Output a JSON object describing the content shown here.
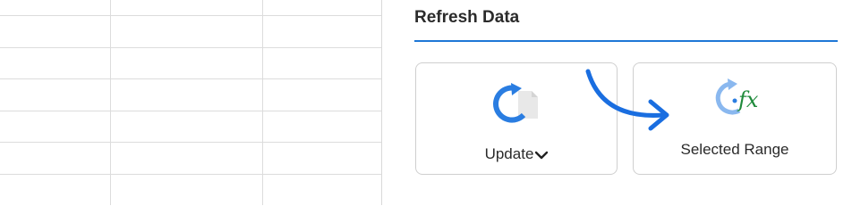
{
  "panel": {
    "title": "Refresh Data",
    "buttons": [
      {
        "label": "Update",
        "icon": "refresh-document-icon",
        "has_dropdown": true
      },
      {
        "label": "Selected Range",
        "icon": "refresh-formula-icon"
      }
    ]
  },
  "colors": {
    "accent": "#1e77d6",
    "refresh_blue": "#2a7de1",
    "refresh_light_blue": "#8ab8ef",
    "formula_green": "#1f8a3b"
  }
}
